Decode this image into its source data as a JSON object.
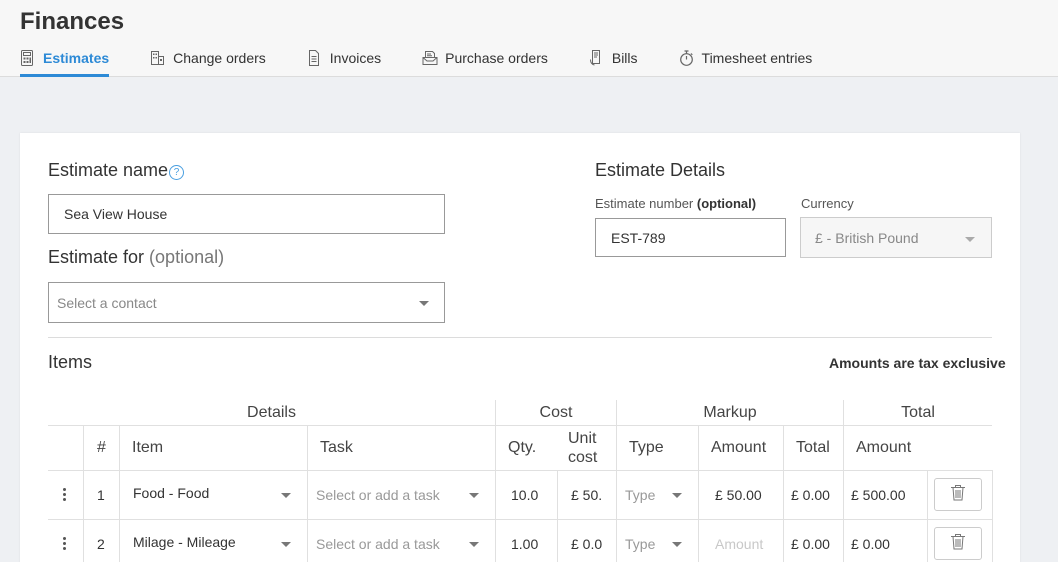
{
  "app": {
    "title": "Finances"
  },
  "tabs": [
    {
      "label": "Estimates",
      "icon": "calculator-icon",
      "active": true
    },
    {
      "label": "Change orders",
      "icon": "building-doc-icon",
      "active": false
    },
    {
      "label": "Invoices",
      "icon": "document-icon",
      "active": false
    },
    {
      "label": "Purchase orders",
      "icon": "cart-doc-icon",
      "active": false
    },
    {
      "label": "Bills",
      "icon": "receipt-icon",
      "active": false
    },
    {
      "label": "Timesheet entries",
      "icon": "stopwatch-icon",
      "active": false
    }
  ],
  "colors": {
    "accent": "#2d8ad6",
    "background": "#eef0f3"
  },
  "form": {
    "estimate_name_label": "Estimate name",
    "estimate_name_value": "Sea View House",
    "estimate_for_label": "Estimate for",
    "estimate_for_optional": "(optional)",
    "estimate_for_placeholder": "Select a contact",
    "details_title": "Estimate Details",
    "estimate_number_label": "Estimate number",
    "estimate_number_optional": "(optional)",
    "estimate_number_value": "EST-789",
    "currency_label": "Currency",
    "currency_value": "£ - British Pound"
  },
  "items": {
    "title": "Items",
    "tax_note": "Amounts are tax exclusive",
    "groups": {
      "details": "Details",
      "cost": "Cost",
      "markup": "Markup",
      "total": "Total"
    },
    "columns": {
      "num": "#",
      "item": "Item",
      "task": "Task",
      "qty": "Qty.",
      "unit_cost_1": "Unit",
      "unit_cost_2": "cost",
      "type": "Type",
      "markup_amount": "Amount",
      "markup_total": "Total",
      "total_amount": "Amount"
    },
    "rows": [
      {
        "num": "1",
        "item": "Food - Food",
        "task": "Select or add a task",
        "qty": "10.0",
        "unit_cost": "£ 50.",
        "type": "Type",
        "markup_amount": "£ 50.00",
        "markup_total": "£ 0.00",
        "total_amount": "£ 500.00"
      },
      {
        "num": "2",
        "item": "Milage - Mileage",
        "task": "Select or add a task",
        "qty": "1.00",
        "unit_cost": "£ 0.0",
        "type": "Type",
        "markup_amount": "Amount",
        "markup_total": "£ 0.00",
        "total_amount": "£ 0.00"
      }
    ]
  }
}
